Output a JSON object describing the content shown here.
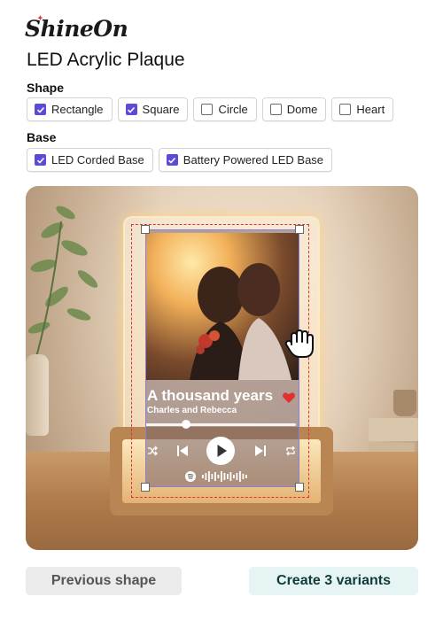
{
  "brand": {
    "logo_text": "ShineOn"
  },
  "product": {
    "title": "LED Acrylic Plaque"
  },
  "shape": {
    "label": "Shape",
    "options": [
      {
        "label": "Rectangle",
        "checked": true
      },
      {
        "label": "Square",
        "checked": true
      },
      {
        "label": "Circle",
        "checked": false
      },
      {
        "label": "Dome",
        "checked": false
      },
      {
        "label": "Heart",
        "checked": false
      }
    ]
  },
  "base": {
    "label": "Base",
    "options": [
      {
        "label": "LED Corded Base",
        "checked": true
      },
      {
        "label": "Battery Powered LED Base",
        "checked": true
      }
    ]
  },
  "preview": {
    "song_title": "A thousand years",
    "artist": "Charles and Rebecca",
    "progress": 0.27,
    "icons": [
      "shuffle-icon",
      "previous-icon",
      "play-icon",
      "next-icon",
      "repeat-icon",
      "heart-icon",
      "spotify-icon"
    ]
  },
  "colors": {
    "accent": "#5b4bd6",
    "selection_dash": "#e0312f",
    "heart": "#e0312f"
  },
  "actions": {
    "previous_label": "Previous shape",
    "create_label": "Create 3 variants"
  }
}
